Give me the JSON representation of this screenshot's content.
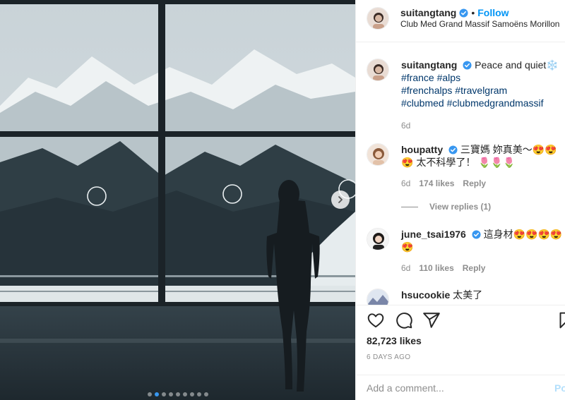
{
  "post": {
    "author": "suitangtang",
    "follow_label": "Follow",
    "follow_separator": "•",
    "location": "Club Med Grand Massif Samoëns Morillon",
    "caption_text": "Peace and quiet❄️",
    "hashtags_line1": [
      "#france",
      "#alps"
    ],
    "hashtags_line2": [
      "#frenchalps",
      "#travelgram"
    ],
    "hashtags_line3": [
      "#clubmed",
      "#clubmedgrandmassif"
    ],
    "caption_age": "6d",
    "likes": "82,723 likes",
    "posted": "6 DAYS AGO",
    "carousel": {
      "count": 9,
      "active_index": 1
    }
  },
  "comments": [
    {
      "user": "houpatty",
      "verified": true,
      "text": "三寶媽 妳真美～😍😍😍 太不科學了！ 🌷🌷🌷",
      "age": "6d",
      "likes": "174 likes",
      "reply_label": "Reply",
      "view_replies": "View replies (1)"
    },
    {
      "user": "june_tsai1976",
      "verified": true,
      "text": "這身材😍😍😍😍😍",
      "age": "6d",
      "likes": "110 likes",
      "reply_label": "Reply"
    },
    {
      "user": "hsucookie",
      "verified": false,
      "text": "太美了"
    }
  ],
  "composer": {
    "placeholder": "Add a comment...",
    "post_label": "Post"
  },
  "icons": {
    "like": "heart-icon",
    "comment": "comment-icon",
    "share": "share-icon",
    "save": "bookmark-icon",
    "verified": "verified-badge-icon",
    "next": "chevron-right-icon"
  },
  "colors": {
    "link_blue": "#0095f6",
    "hashtag": "#00376b",
    "muted": "#8e8e8e",
    "post_disabled": "#b2dffc",
    "verified": "#3897f0"
  }
}
